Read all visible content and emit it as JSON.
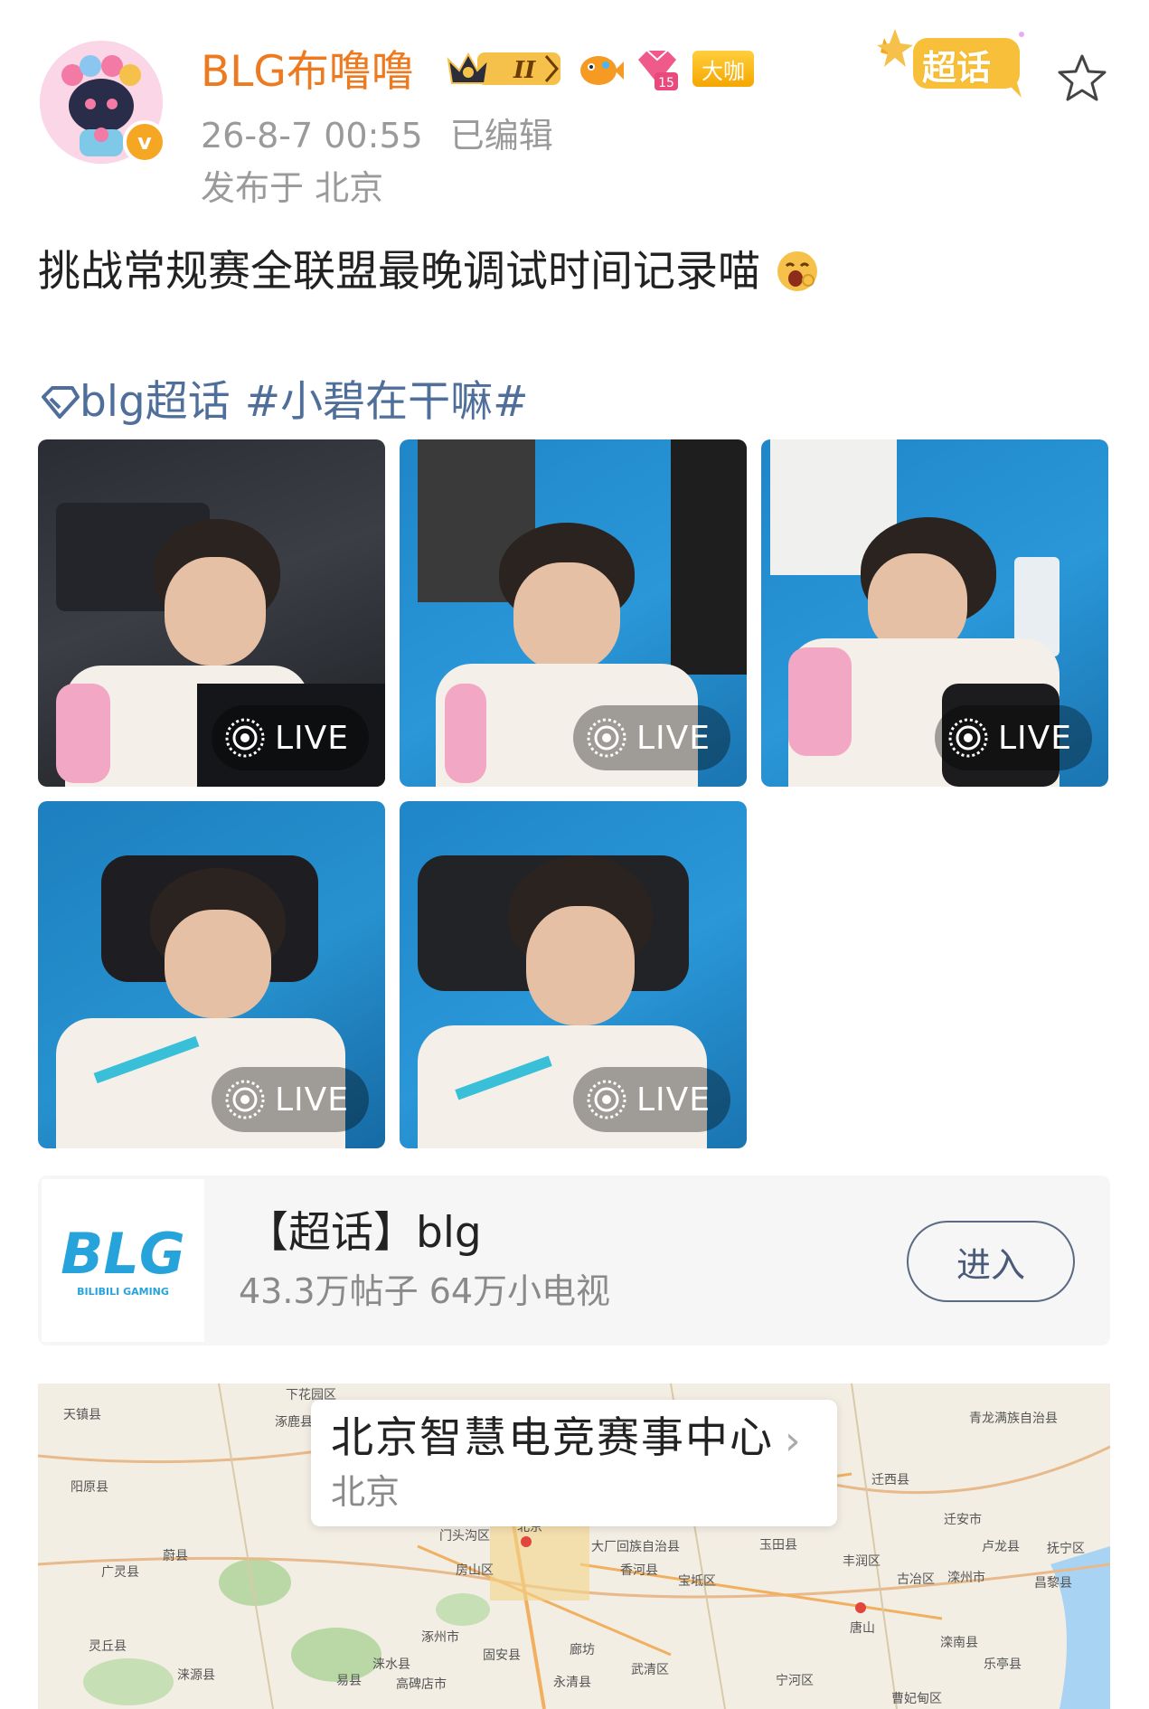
{
  "post": {
    "username": "BLG布噜噜",
    "verified_mark": "v",
    "badge_level": "II",
    "badge_gem_level": "15",
    "badge_daka": "大咖",
    "timestamp": "26-8-7 00:55",
    "edited": "已编辑",
    "location": "发布于 北京",
    "chaohua_label": "超话",
    "text": "挑战常规赛全联盟最晚调试时间记录喵",
    "hashtag_topic": "blg超话",
    "hashtag": "#小碧在干嘛#"
  },
  "photos": [
    {
      "live": "LIVE"
    },
    {
      "live": "LIVE"
    },
    {
      "live": "LIVE"
    },
    {
      "live": "LIVE"
    },
    {
      "live": "LIVE"
    }
  ],
  "topic_card": {
    "title": "【超话】blg",
    "stats": "43.3万帖子 64万小电视",
    "enter_label": "进入",
    "logo_text": "BLG",
    "logo_subtext": "BILIBILI GAMING"
  },
  "map": {
    "place_name": "北京智慧电竞赛事中心",
    "city": "北京",
    "labels": [
      "天镇县",
      "下花园区",
      "涿鹿县",
      "阳原县",
      "蔚县",
      "广灵县",
      "灵丘县",
      "涞源县",
      "易县",
      "涞水县",
      "涿州市",
      "房山区",
      "门头沟区",
      "北京",
      "大厂回族自治县",
      "香河县",
      "宝坻区",
      "玉田县",
      "丰润区",
      "迁西县",
      "迁安市",
      "卢龙县",
      "抚宁区",
      "昌黎县",
      "滦州市",
      "古冶区",
      "唐山",
      "滦南县",
      "乐亭县",
      "廊坊",
      "永清县",
      "固安县",
      "武清区",
      "宁河区",
      "高碑店市",
      "青龙满族自治县",
      "曹妃甸区"
    ]
  },
  "colors": {
    "username": "#ee7a20",
    "hashtag": "#4f6f9a",
    "meta": "#9a9a9a"
  }
}
